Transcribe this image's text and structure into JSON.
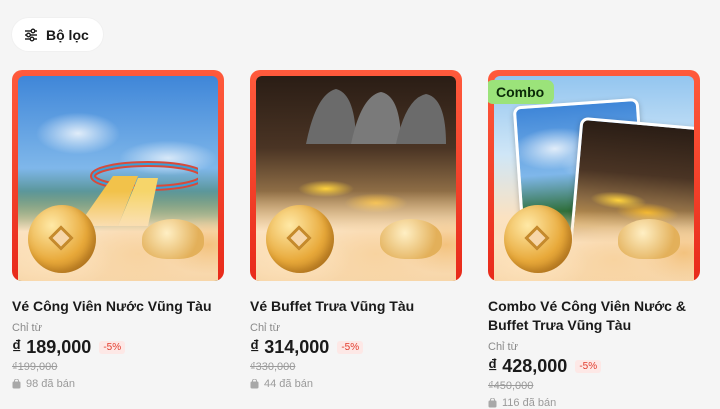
{
  "filter": {
    "label": "Bộ lọc",
    "icon": "sliders-icon"
  },
  "products": [
    {
      "image": "water-park",
      "title": "Vé Công Viên Nước Vũng Tàu",
      "from_label": "Chỉ từ",
      "price": "₫ 189,000",
      "discount": "-5%",
      "old_price": "₫199,000",
      "sold": "98 đã bán"
    },
    {
      "image": "buffet",
      "title": "Vé Buffet Trưa Vũng Tàu",
      "from_label": "Chỉ từ",
      "price": "₫ 314,000",
      "discount": "-5%",
      "old_price": "₫330,000",
      "sold": "44 đã bán"
    },
    {
      "image": "combo",
      "tag": "Combo",
      "title": "Combo Vé Công Viên Nước & Buffet Trưa Vũng Tàu",
      "from_label": "Chỉ từ",
      "price": "₫ 428,000",
      "discount": "-5%",
      "old_price": "₫450,000",
      "sold": "116 đã bán"
    }
  ],
  "colors": {
    "frame": "#e82a1a",
    "combo_tag": "#9be37a",
    "discount": "#e23b2c"
  }
}
